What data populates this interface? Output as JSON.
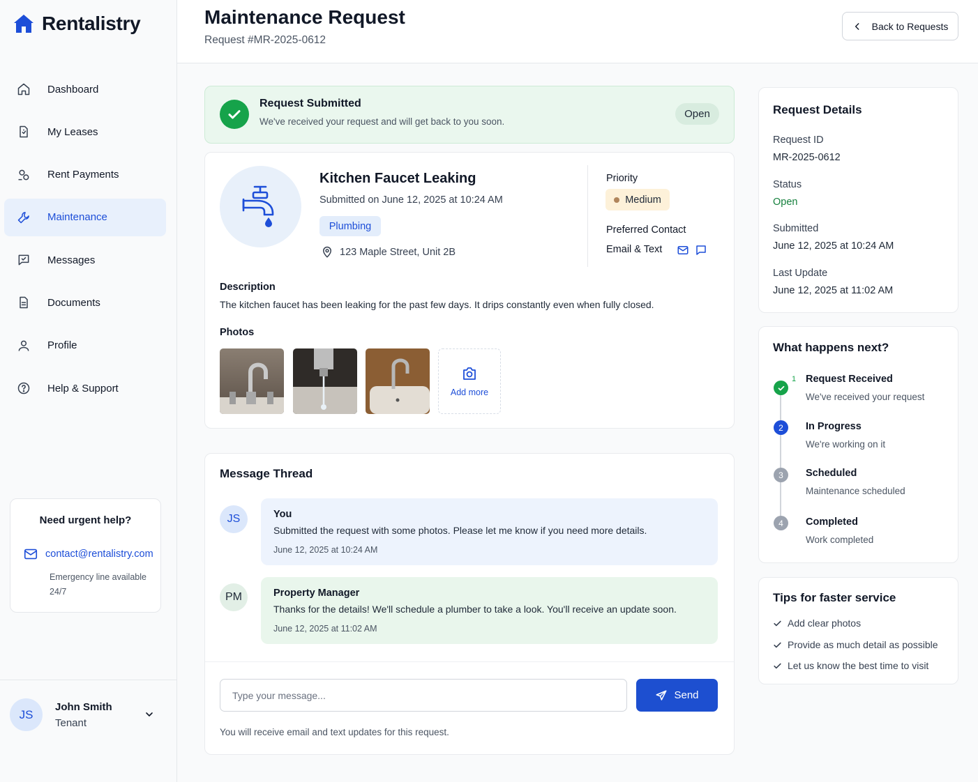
{
  "app": {
    "name": "Rentalistry"
  },
  "sidebar": {
    "items": [
      {
        "label": "Dashboard",
        "icon": "home-icon"
      },
      {
        "label": "My Leases",
        "icon": "lease-document-icon"
      },
      {
        "label": "Rent Payments",
        "icon": "payments-icon"
      },
      {
        "label": "Maintenance",
        "icon": "wrench-icon",
        "active": true
      },
      {
        "label": "Messages",
        "icon": "chat-icon"
      },
      {
        "label": "Documents",
        "icon": "document-icon"
      },
      {
        "label": "Profile",
        "icon": "user-icon"
      },
      {
        "label": "Help & Support",
        "icon": "help-circle-icon"
      }
    ],
    "help": {
      "title": "Need urgent help?",
      "email": "contact@rentalistry.com",
      "note": "Emergency line available 24/7"
    },
    "user": {
      "initials": "JS",
      "name": "John Smith",
      "role": "Tenant"
    }
  },
  "header": {
    "title": "Maintenance Request",
    "subtitle": "Request #MR-2025-0612",
    "back_label": "Back to Requests"
  },
  "banner": {
    "title": "Request Submitted",
    "text": "We've received your request and will get back to you soon.",
    "badge": "Open"
  },
  "request": {
    "title": "Kitchen Faucet Leaking",
    "submitted": "Submitted on June 12, 2025 at 10:24 AM",
    "category": "Plumbing",
    "address": "123 Maple Street, Unit 2B",
    "priority_label": "Priority",
    "priority": "Medium",
    "contact_label": "Preferred Contact",
    "contact": "Email & Text",
    "description_label": "Description",
    "description": "The kitchen faucet has been leaking for the past few days. It drips constantly even when fully closed.",
    "photos_label": "Photos",
    "add_more": "Add more"
  },
  "thread": {
    "title": "Message Thread",
    "messages": [
      {
        "initials": "JS",
        "author": "You",
        "text": "Submitted the request with some photos. Please let me know if you need more details.",
        "time": "June 12, 2025 at 10:24 AM"
      },
      {
        "initials": "PM",
        "author": "Property Manager",
        "text": "Thanks for the details! We'll schedule a plumber to take a look. You'll receive an update soon.",
        "time": "June 12, 2025 at 11:02 AM"
      }
    ],
    "input_placeholder": "Type your message...",
    "send_label": "Send",
    "note": "You will receive email and text updates for this request."
  },
  "details": {
    "title": "Request Details",
    "fields": [
      {
        "label": "Request ID",
        "value": "MR-2025-0612"
      },
      {
        "label": "Status",
        "value": "Open"
      },
      {
        "label": "Submitted",
        "value": "June 12, 2025 at 10:24 AM"
      },
      {
        "label": "Last Update",
        "value": "June 12, 2025 at 11:02 AM"
      }
    ]
  },
  "next": {
    "title": "What happens next?",
    "steps": [
      {
        "num": "1",
        "title": "Request Received",
        "sub": "We've received your request",
        "state": "done"
      },
      {
        "num": "2",
        "title": "In Progress",
        "sub": "We're working on it",
        "state": "current"
      },
      {
        "num": "3",
        "title": "Scheduled",
        "sub": "Maintenance scheduled",
        "state": "pending"
      },
      {
        "num": "4",
        "title": "Completed",
        "sub": "Work completed",
        "state": "pending"
      }
    ]
  },
  "tips": {
    "title": "Tips for faster service",
    "items": [
      "Add clear photos",
      "Provide as much detail as possible",
      "Let us know the best time to visit"
    ]
  },
  "colors": {
    "accent": "#1d4ed8",
    "success": "#16a34a",
    "priority_medium_bg": "#fdf1d9"
  }
}
